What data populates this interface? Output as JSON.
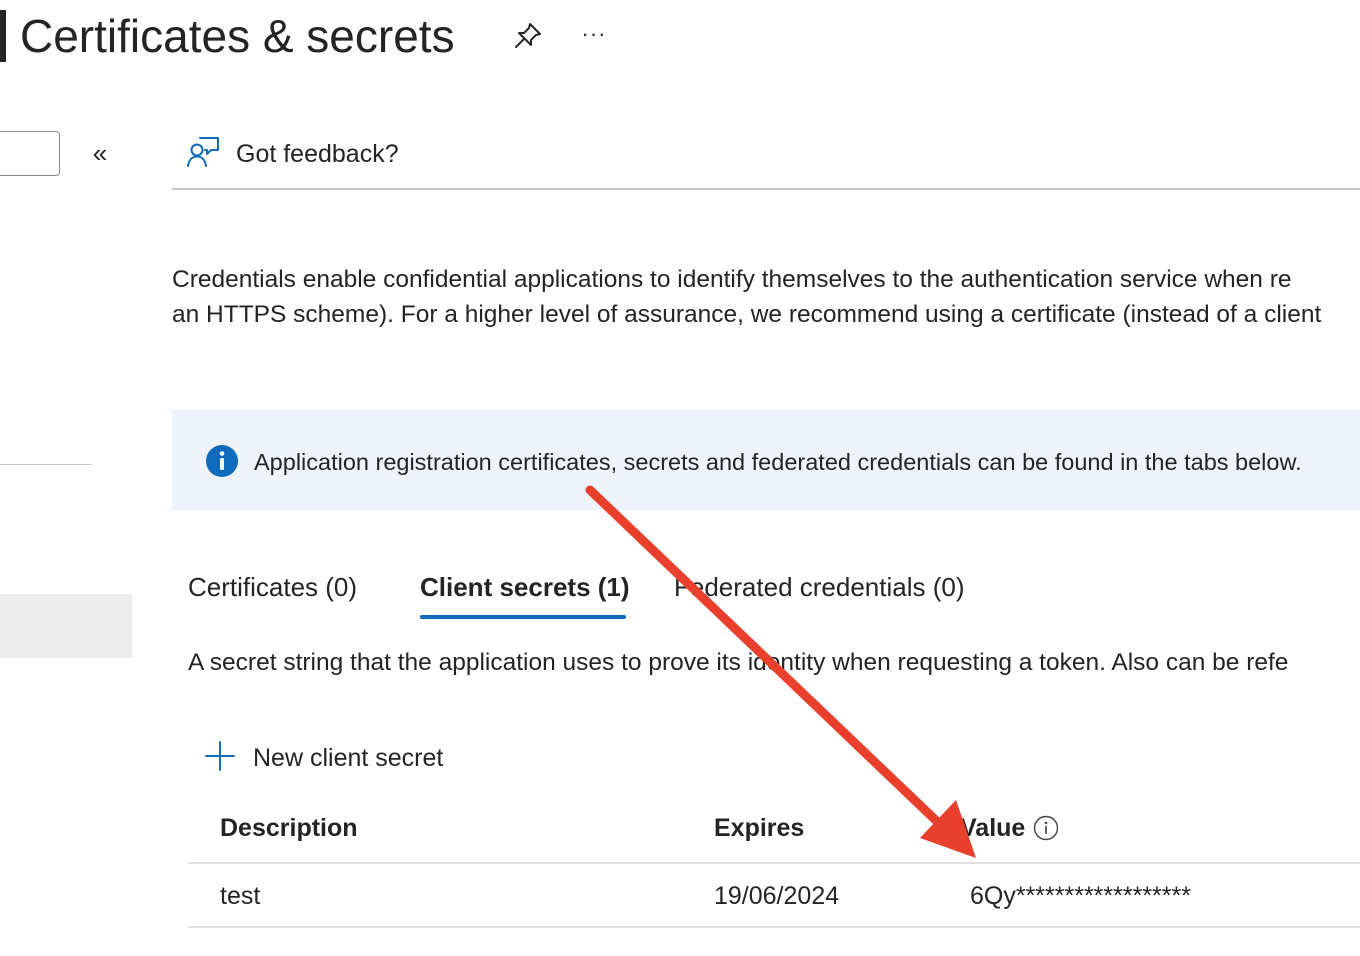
{
  "header": {
    "title": "Certificates & secrets",
    "pin_icon": "pin-icon",
    "more_label": "···"
  },
  "sidebar": {
    "collapse_label": "«"
  },
  "toolbar": {
    "feedback_label": "Got feedback?",
    "feedback_icon": "feedback-person-icon"
  },
  "description": {
    "line1": "Credentials enable confidential applications to identify themselves to the authentication service when re",
    "line2": "an HTTPS scheme). For a higher level of assurance, we recommend using a certificate (instead of a client"
  },
  "banner": {
    "text": "Application registration certificates, secrets and federated credentials can be found in the tabs below.",
    "icon": "info-icon",
    "color": "#eff4fb"
  },
  "tabs": [
    {
      "label": "Certificates (0)",
      "selected": false
    },
    {
      "label": "Client secrets (1)",
      "selected": true
    },
    {
      "label": "Federated credentials (0)",
      "selected": false
    }
  ],
  "secrets": {
    "description": "A secret string that the application uses to prove its identity when requesting a token. Also can be refe",
    "new_button_label": "New client secret",
    "columns": [
      "Description",
      "Expires",
      "Value"
    ],
    "rows": [
      {
        "description": "test",
        "expires": "19/06/2024",
        "value": "6Qy******************"
      }
    ]
  },
  "colors": {
    "accent": "#0f6cbd",
    "annotation_arrow": "#e8402c"
  }
}
